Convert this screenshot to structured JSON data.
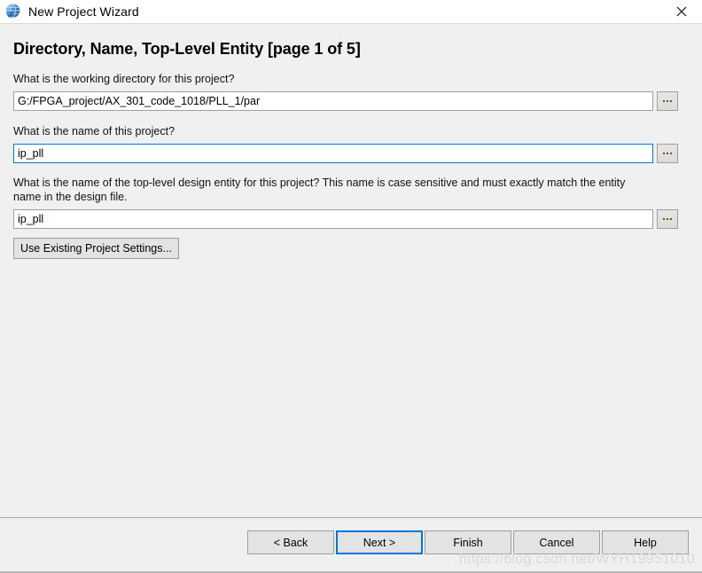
{
  "window": {
    "title": "New Project Wizard",
    "icon": "globe-icon",
    "close_label": "✕",
    "accent_color": "#0078d7",
    "background_color": "#f0f0f0"
  },
  "page": {
    "heading": "Directory, Name, Top-Level Entity [page 1 of 5]"
  },
  "fields": [
    {
      "question": "What is the working directory for this project?",
      "value": "G:/FPGA_project/AX_301_code_1018/PLL_1/par",
      "placeholder": "",
      "focused": false,
      "browse_label": "..."
    },
    {
      "question": "What is the name of this project?",
      "value": "ip_pll",
      "placeholder": "",
      "focused": true,
      "browse_label": "..."
    },
    {
      "question": "What is the name of the top-level design entity for this project? This name is case sensitive and must exactly match the entity name in the design file.",
      "value": "ip_pll",
      "placeholder": "",
      "focused": false,
      "browse_label": "..."
    }
  ],
  "settings_button": {
    "label": "Use Existing Project Settings..."
  },
  "footer": {
    "buttons": [
      {
        "label": "< Back",
        "default": false
      },
      {
        "label": "Next >",
        "default": true
      },
      {
        "label": "Finish",
        "default": false
      },
      {
        "label": "Cancel",
        "default": false
      },
      {
        "label": "Help",
        "default": false
      }
    ],
    "watermark": "https://blog.csdn.net/WYH19951010"
  }
}
